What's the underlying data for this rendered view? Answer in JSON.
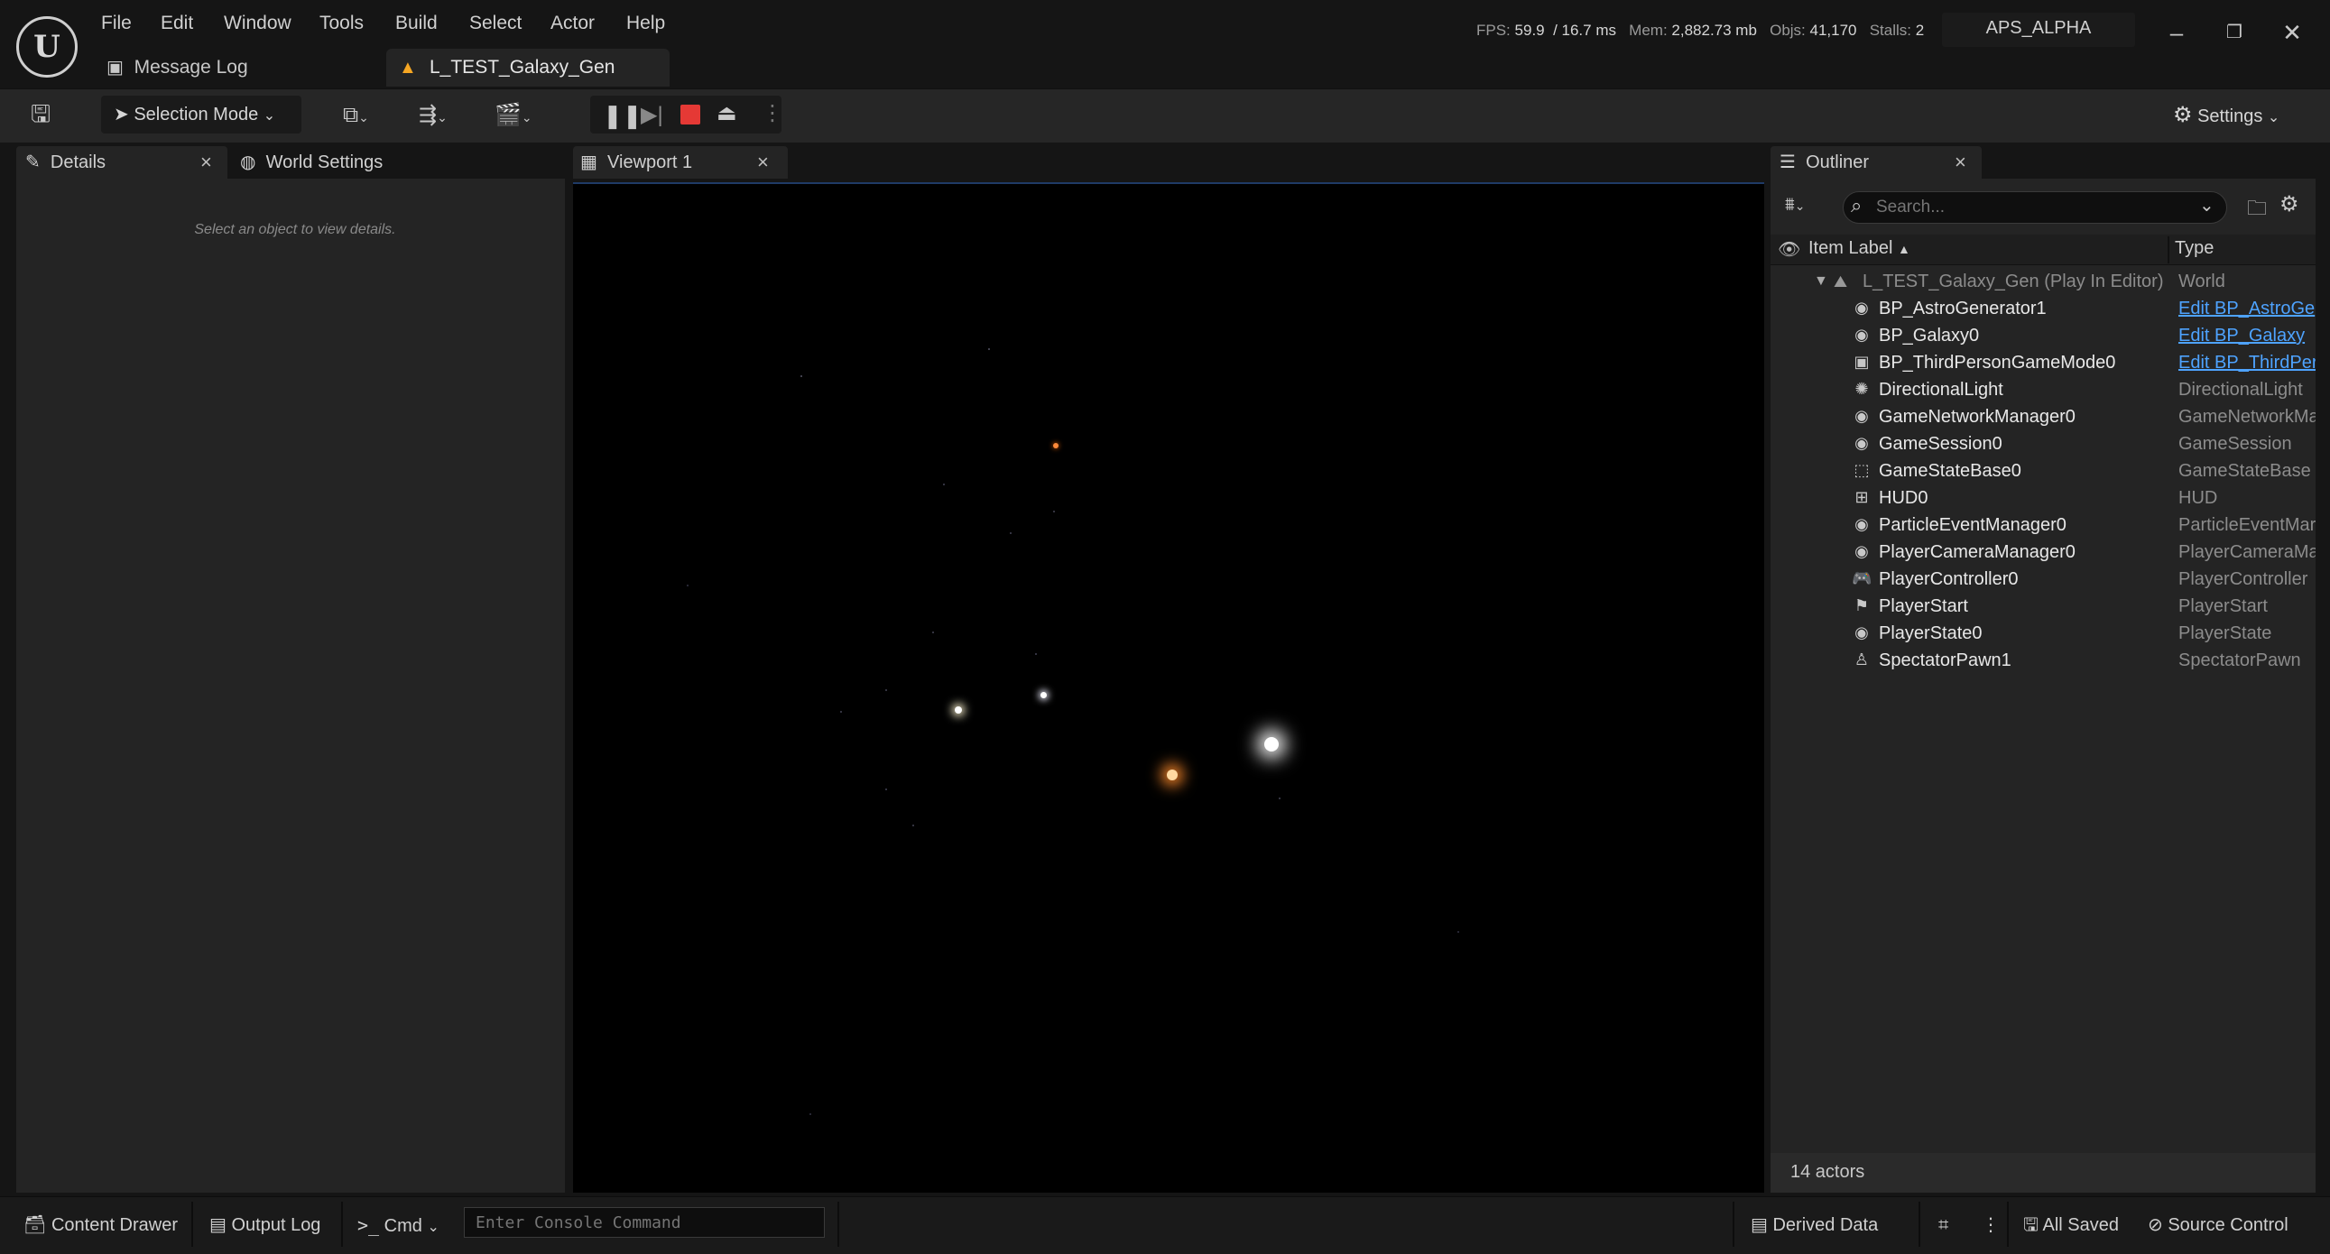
{
  "menu": [
    "File",
    "Edit",
    "Window",
    "Tools",
    "Build",
    "Select",
    "Actor",
    "Help"
  ],
  "stats": {
    "fps_label": "FPS:",
    "fps": "59.9",
    "ms": "/ 16.7 ms",
    "mem_label": "Mem:",
    "mem": "2,882.73 mb",
    "objs_label": "Objs:",
    "objs": "41,170",
    "stalls_label": "Stalls:",
    "stalls": "2"
  },
  "project_name": "APS_ALPHA",
  "doc_tabs": {
    "message_log": "Message Log",
    "level": "L_TEST_Galaxy_Gen"
  },
  "toolbar": {
    "selection_mode": "Selection Mode",
    "settings": "Settings"
  },
  "left_tabs": {
    "details": "Details",
    "world_settings": "World Settings"
  },
  "details_empty": "Select an object to view details.",
  "viewport_tab": "Viewport 1",
  "outliner": {
    "title": "Outliner",
    "search_placeholder": "Search...",
    "col_label": "Item Label",
    "col_type": "Type",
    "root": {
      "label": "L_TEST_Galaxy_Gen (Play In Editor)",
      "type": "World"
    },
    "items": [
      {
        "label": "BP_AstroGenerator1",
        "type": "Edit BP_AstroGe",
        "link": true,
        "icon": "actor-icon"
      },
      {
        "label": "BP_Galaxy0",
        "type": "Edit BP_Galaxy",
        "link": true,
        "icon": "actor-icon"
      },
      {
        "label": "BP_ThirdPersonGameMode0",
        "type": "Edit BP_ThirdPer",
        "link": true,
        "icon": "gamemode-icon"
      },
      {
        "label": "DirectionalLight",
        "type": "DirectionalLight",
        "link": false,
        "icon": "light-icon"
      },
      {
        "label": "GameNetworkManager0",
        "type": "GameNetworkMa",
        "link": false,
        "icon": "actor-icon"
      },
      {
        "label": "GameSession0",
        "type": "GameSession",
        "link": false,
        "icon": "actor-icon"
      },
      {
        "label": "GameStateBase0",
        "type": "GameStateBase",
        "link": false,
        "icon": "gamestate-icon"
      },
      {
        "label": "HUD0",
        "type": "HUD",
        "link": false,
        "icon": "hud-icon"
      },
      {
        "label": "ParticleEventManager0",
        "type": "ParticleEventMar",
        "link": false,
        "icon": "actor-icon"
      },
      {
        "label": "PlayerCameraManager0",
        "type": "PlayerCameraMa",
        "link": false,
        "icon": "actor-icon"
      },
      {
        "label": "PlayerController0",
        "type": "PlayerController",
        "link": false,
        "icon": "gamepad-icon"
      },
      {
        "label": "PlayerStart",
        "type": "PlayerStart",
        "link": false,
        "icon": "flag-icon"
      },
      {
        "label": "PlayerState0",
        "type": "PlayerState",
        "link": false,
        "icon": "actor-icon"
      },
      {
        "label": "SpectatorPawn1",
        "type": "SpectatorPawn",
        "link": false,
        "icon": "pawn-icon"
      }
    ],
    "actor_count": "14 actors"
  },
  "statusbar": {
    "content_drawer": "Content Drawer",
    "output_log": "Output Log",
    "cmd": "Cmd",
    "console_placeholder": "Enter Console Command",
    "derived_data": "Derived Data",
    "all_saved": "All Saved",
    "source_control": "Source Control"
  },
  "colors": {
    "accent_blue": "#4ea3ff",
    "stop_red": "#e53935",
    "level_icon": "#f5a623"
  }
}
